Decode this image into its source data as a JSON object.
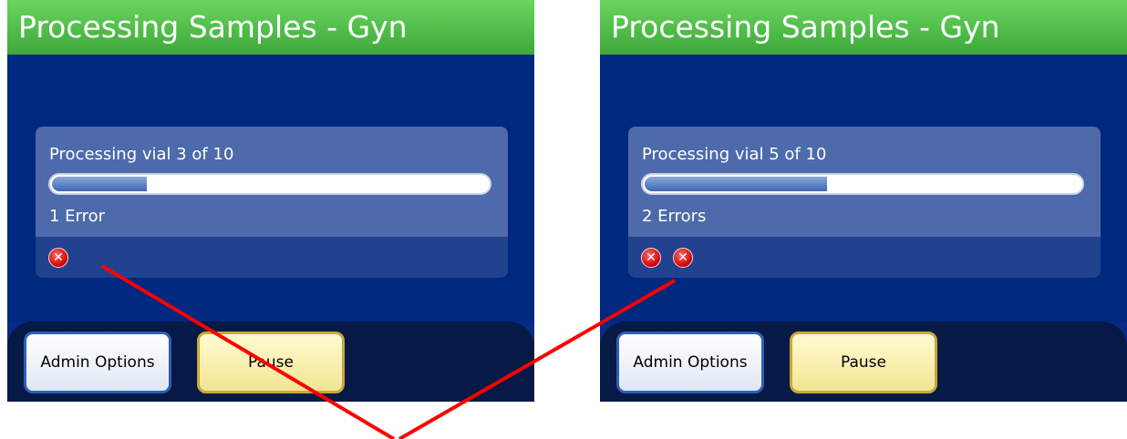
{
  "screens": [
    {
      "header_title": "Processing Samples - Gyn",
      "status": "Processing vial 3 of 10",
      "progress": 0.22,
      "errors_text": "1 Error",
      "error_icon_count": 1,
      "buttons": {
        "admin": "Admin Options",
        "pause": "Pause"
      }
    },
    {
      "header_title": "Processing Samples - Gyn",
      "status": "Processing vial 5 of 10",
      "progress": 0.42,
      "errors_text": "2 Errors",
      "error_icon_count": 2,
      "buttons": {
        "admin": "Admin Options",
        "pause": "Pause"
      }
    }
  ],
  "icons": {
    "error": "error-x-icon"
  },
  "colors": {
    "header_green": "#4cbc45",
    "screen_blue": "#00287f",
    "progress_fill": "#3d67b4",
    "error_red": "#cc0000",
    "annotation_line": "#ff0000"
  }
}
